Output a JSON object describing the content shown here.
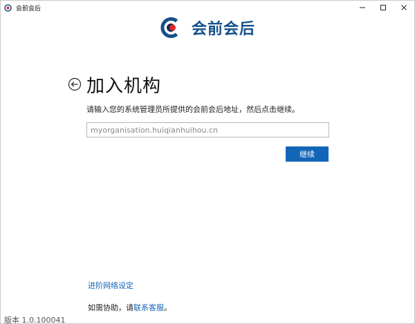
{
  "window": {
    "title": "会前会后",
    "controls": [
      "minimize-icon",
      "maximize-icon",
      "close-icon"
    ]
  },
  "logo": {
    "text": "会前会后",
    "colors": {
      "ring": "#14508a",
      "dot_red": "#d52b2b",
      "dot_dark": "#1a2a4a"
    }
  },
  "page": {
    "title": "加入机构",
    "instruction": "请输入您的系统管理员所提供的会前会后地址，然后点击继续。"
  },
  "form": {
    "url_placeholder": "myorganisation.huiqianhuihou.cn",
    "url_value": "",
    "continue_label": "继续"
  },
  "footer": {
    "advanced_network_label": "进阶网络设定",
    "help_prefix": "如需协助，请",
    "help_link_label": "联系客服",
    "help_suffix": "。",
    "version": "版本 1.0.100041"
  },
  "colors": {
    "accent": "#1365b8",
    "link": "#1464b4",
    "brand_text": "#14508a"
  }
}
